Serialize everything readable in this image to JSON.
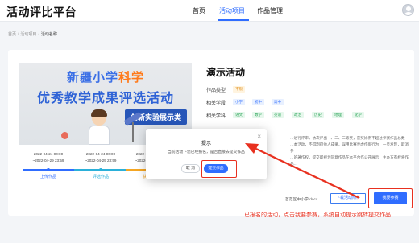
{
  "header": {
    "logo": "活动评比平台",
    "nav": [
      "首页",
      "活动项目",
      "作品管理"
    ]
  },
  "breadcrumb": [
    "首页",
    "活动项目",
    "活动名称"
  ],
  "poster": {
    "title_line1_a": "新疆小学",
    "title_line1_b": "科学",
    "title_line2": "优秀教学成果评选活动",
    "banner": "创新实验展示类"
  },
  "timeline": [
    {
      "start": "2022-04-24 00:00",
      "end": "~2022-04-29 23:59",
      "label": "上传作品",
      "color": "#2f6dff"
    },
    {
      "start": "2022-04-24 00:00",
      "end": "~2022-04-29 23:59",
      "label": "评选作品",
      "color": "#2bb0d9"
    },
    {
      "start": "2022-04-24 00:00",
      "end": "~2022-04-30 23:59",
      "label": "获奖公示",
      "color": "#f5a623"
    }
  ],
  "activity": {
    "title": "演示活动",
    "type_label": "作品类型",
    "type_tag": "不限",
    "section_label": "相关学段",
    "section_tags": [
      "小学",
      "初中",
      "高中"
    ],
    "subject_label": "相关学科",
    "subject_tags": [
      "语文",
      "数学",
      "英语",
      "政治",
      "历史",
      "地理",
      "化学"
    ],
    "desc_line1": "…进行评审，依次评出一、二、三等奖，获奖比例不超过参赛作品总数",
    "desc_line2": "…本活动，不得剽窃他人成果，误用比赛弄虚作假行为，一旦发现，取消参",
    "desc_line3": "…的著作权，提交即视为同意作品在本平台作公开展示，主办方有权将作品…"
  },
  "actions": {
    "file_name": "首范区中小学.docx",
    "download": "下载活动附件",
    "enroll": "我要参赛"
  },
  "dialog": {
    "title": "提示",
    "message": "当前活动下您已经报名，是否直接去提交作品",
    "cancel": "取 消",
    "submit": "提交作品",
    "close_icon": "close-icon"
  },
  "annotation": "已报名的活动，点击我要参赛，系统自动提示跳转提交作品",
  "colors": {
    "accent": "#2f6dff",
    "highlight": "#e8301f"
  }
}
